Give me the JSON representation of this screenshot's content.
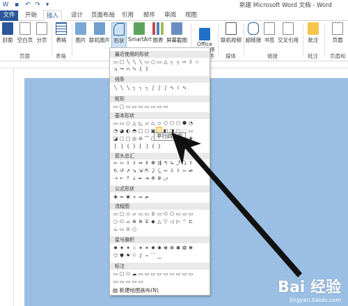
{
  "window": {
    "title": "新建 Microsoft Word 文档 - Word"
  },
  "quick_access": [
    "save-icon",
    "undo-icon",
    "redo-icon",
    "customize-icon"
  ],
  "tabs": [
    {
      "label": "文件"
    },
    {
      "label": "开始"
    },
    {
      "label": "插入"
    },
    {
      "label": "设计"
    },
    {
      "label": "页面布局"
    },
    {
      "label": "引用"
    },
    {
      "label": "邮件"
    },
    {
      "label": "审阅"
    },
    {
      "label": "视图"
    }
  ],
  "ribbon": {
    "buttons": [
      {
        "label": "封面"
      },
      {
        "label": "空白页"
      },
      {
        "label": "分页"
      },
      {
        "label": "表格"
      },
      {
        "label": "图片"
      },
      {
        "label": "联机图片"
      },
      {
        "label": "形状"
      },
      {
        "label": "SmartArt"
      },
      {
        "label": "图表"
      },
      {
        "label": "屏幕截图"
      },
      {
        "label": "Office\n应用程序"
      },
      {
        "label": "联机视频"
      },
      {
        "label": "超链接"
      },
      {
        "label": "书签"
      },
      {
        "label": "交叉引用"
      },
      {
        "label": "批注"
      },
      {
        "label": "页眉"
      }
    ],
    "groups": [
      {
        "label": "页面"
      },
      {
        "label": "表格"
      },
      {
        "label": "应用程序"
      },
      {
        "label": "媒体"
      },
      {
        "label": "链接"
      },
      {
        "label": "批注"
      },
      {
        "label": "页眉和"
      }
    ]
  },
  "dropdown": {
    "sections": [
      {
        "label": "最近使用的形状"
      },
      {
        "label": "线条"
      },
      {
        "label": "矩形"
      },
      {
        "label": "基本形状"
      },
      {
        "label": "箭头总汇"
      },
      {
        "label": "公式形状"
      },
      {
        "label": "流程图"
      },
      {
        "label": "星与旗帜"
      },
      {
        "label": "标注"
      }
    ],
    "tooltip": "平行四边形",
    "new_canvas": "新建绘图画布(N)"
  },
  "watermark": {
    "logo": "Bai 经验",
    "url": "jingyan.baidu.com"
  },
  "colors": {
    "brand": "#2b579a",
    "page": "#9bbfe4",
    "selected": "#cde3f5"
  }
}
